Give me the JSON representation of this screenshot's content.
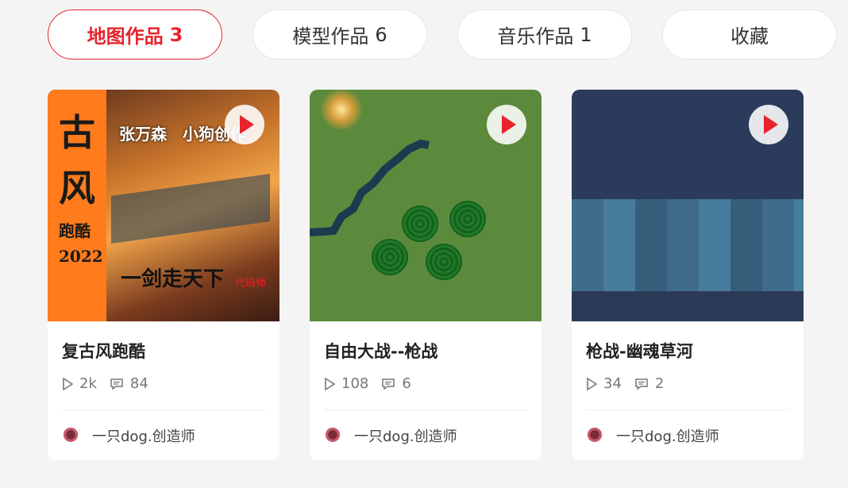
{
  "tabs": [
    {
      "label": "地图作品",
      "count": "3",
      "active": true
    },
    {
      "label": "模型作品",
      "count": "6",
      "active": false
    },
    {
      "label": "音乐作品",
      "count": "1",
      "active": false
    },
    {
      "label": "收藏",
      "count": "",
      "active": false
    }
  ],
  "cards": [
    {
      "title": "复古风跑酷",
      "plays": "2k",
      "comments": "84",
      "author": "一只dog.创造师",
      "thumb_text": {
        "big1": "古",
        "big2": "风",
        "sub1": "跑酷",
        "year": "2022",
        "names": "张万森　小狗创作",
        "slogan": "一剑走天下",
        "small": "代码师"
      }
    },
    {
      "title": "自由大战--枪战",
      "plays": "108",
      "comments": "6",
      "author": "一只dog.创造师"
    },
    {
      "title": "枪战-幽魂草河",
      "plays": "34",
      "comments": "2",
      "author": "一只dog.创造师"
    }
  ],
  "colors": {
    "accent": "#e8232b",
    "background": "#f4f4f4"
  },
  "icons": {
    "play": "play-icon",
    "comment": "comment-icon",
    "views": "play-outline-icon"
  }
}
